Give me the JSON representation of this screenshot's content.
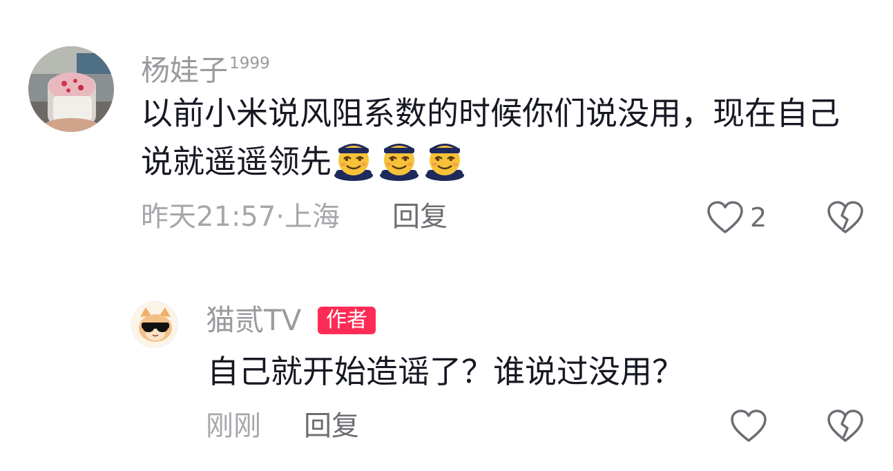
{
  "comments": [
    {
      "username": "杨娃子",
      "username_sup": "1999",
      "content": "以前小米说风阻系数的时候你们说没用，现在自己说就遥遥领先",
      "emojis": [
        "proud-face-emoji",
        "proud-face-emoji",
        "proud-face-emoji"
      ],
      "time_location": "昨天21:57·上海",
      "reply_label": "回复",
      "like_count": "2"
    },
    {
      "username": "猫贰TV",
      "author_badge": "作者",
      "content": "自己就开始造谣了？谁说过没用？",
      "time_location": "刚刚",
      "reply_label": "回复"
    }
  ],
  "colors": {
    "text": "#161823",
    "secondary": "#9a9a9f",
    "author_badge": "#fe2c55",
    "background": "#ffffff"
  }
}
